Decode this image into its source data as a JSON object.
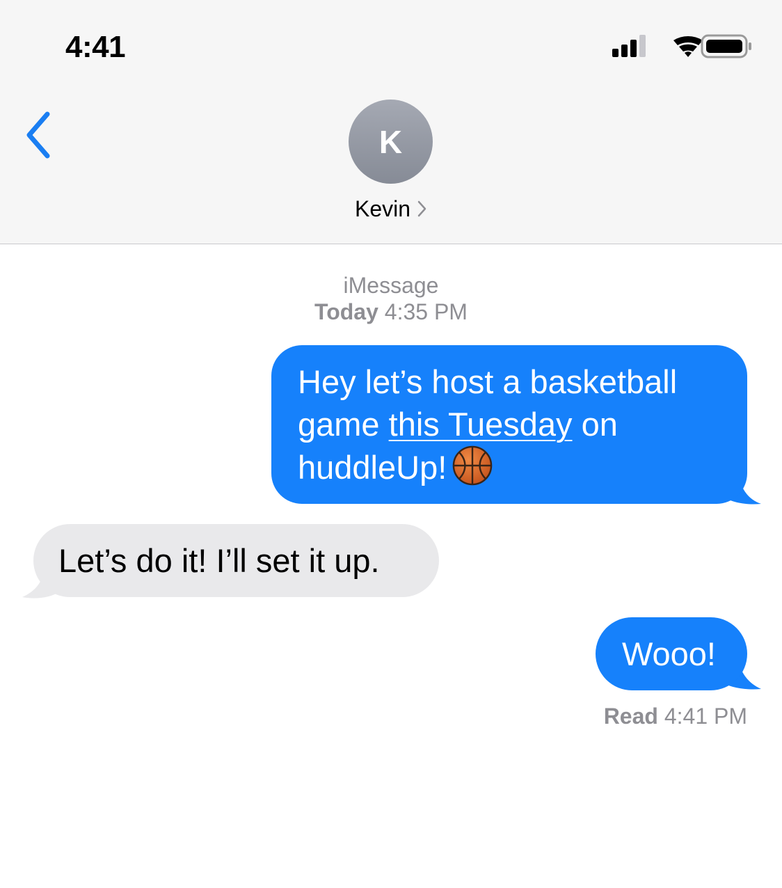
{
  "status_bar": {
    "time": "4:41"
  },
  "header": {
    "avatar_initial": "K",
    "contact_name": "Kevin",
    "icons": [
      "back-chevron-icon",
      "chevron-right-icon",
      "signal-icon",
      "wifi-icon",
      "battery-icon"
    ]
  },
  "thread": {
    "service": "iMessage",
    "date_label": "Today",
    "date_time": "4:35 PM",
    "messages": [
      {
        "direction": "outgoing",
        "line1": "Hey let’s host a basketball",
        "line2_prefix": "game ",
        "line2_link": "this Tuesday",
        "line2_suffix": " on",
        "line3": "huddleUp!",
        "emoji": "basketball-emoji"
      },
      {
        "direction": "incoming",
        "text": "Let’s do it! I’ll set it up."
      },
      {
        "direction": "outgoing",
        "text": "Wooo!"
      }
    ],
    "receipt_label": "Read",
    "receipt_time": "4:41 PM"
  },
  "colors": {
    "outgoing_bubble": "#1681fb",
    "incoming_bubble": "#e9e9eb",
    "accent": "#1a7ef2",
    "meta_text": "#8e8e93",
    "header_bg": "#f6f6f6"
  }
}
